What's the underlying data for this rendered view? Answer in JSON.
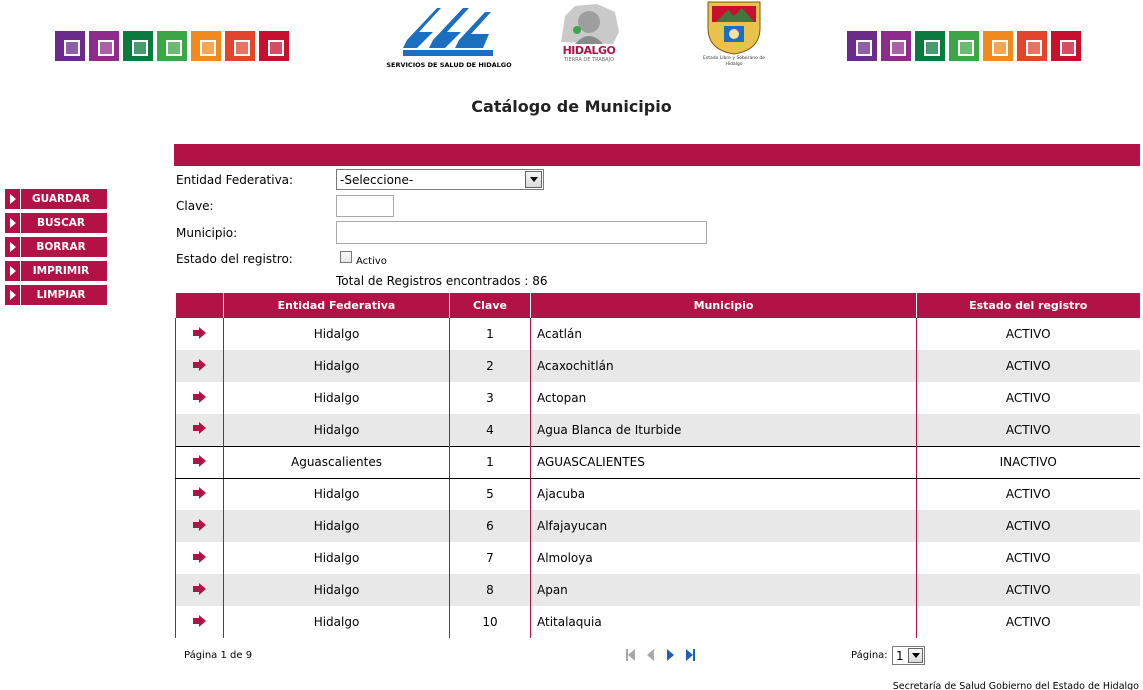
{
  "header": {
    "left_squares": [
      "#6b2b8a",
      "#8e2c8c",
      "#0b7a3e",
      "#3aa645",
      "#f08a1c",
      "#e2452c",
      "#c8102e"
    ],
    "right_squares": [
      "#6b2b8a",
      "#8e2c8c",
      "#0b7a3e",
      "#3aa645",
      "#f08a1c",
      "#e2452c",
      "#c8102e"
    ],
    "logo_ssh_caption": "SERVICIOS DE SALUD DE HIDALGO",
    "logo_hidalgo_text": "HIDALGO",
    "logo_hidalgo_sub": "TIERRA DE TRABAJO",
    "logo_escudo_text": "Estado Libre y Soberano de Hidalgo"
  },
  "page_title": "Catálogo de Municipio",
  "sidebar": {
    "items": [
      {
        "label": "GUARDAR"
      },
      {
        "label": "BUSCAR"
      },
      {
        "label": "BORRAR"
      },
      {
        "label": "IMPRIMIR"
      },
      {
        "label": "LIMPIAR"
      }
    ]
  },
  "form": {
    "entidad_label": "Entidad Federativa:",
    "entidad_value": "-Seleccione-",
    "clave_label": "Clave:",
    "clave_value": "",
    "municipio_label": "Municipio:",
    "municipio_value": "",
    "estado_label": "Estado del registro:",
    "activo_label": "Activo",
    "total_text": "Total de Registros encontrados : 86"
  },
  "table": {
    "headers": [
      "",
      "Entidad Federativa",
      "Clave",
      "Municipio",
      "Estado del registro"
    ],
    "rows": [
      {
        "entidad": "Hidalgo",
        "clave": "1",
        "municipio": "Acatlán",
        "estado": "ACTIVO"
      },
      {
        "entidad": "Hidalgo",
        "clave": "2",
        "municipio": "Acaxochitlán",
        "estado": "ACTIVO"
      },
      {
        "entidad": "Hidalgo",
        "clave": "3",
        "municipio": "Actopan",
        "estado": "ACTIVO"
      },
      {
        "entidad": "Hidalgo",
        "clave": "4",
        "municipio": "Agua Blanca de Iturbide",
        "estado": "ACTIVO"
      },
      {
        "entidad": "Aguascalientes",
        "clave": "1",
        "municipio": "AGUASCALIENTES",
        "estado": "INACTIVO"
      },
      {
        "entidad": "Hidalgo",
        "clave": "5",
        "municipio": "Ajacuba",
        "estado": "ACTIVO"
      },
      {
        "entidad": "Hidalgo",
        "clave": "6",
        "municipio": "Alfajayucan",
        "estado": "ACTIVO"
      },
      {
        "entidad": "Hidalgo",
        "clave": "7",
        "municipio": "Almoloya",
        "estado": "ACTIVO"
      },
      {
        "entidad": "Hidalgo",
        "clave": "8",
        "municipio": "Apan",
        "estado": "ACTIVO"
      },
      {
        "entidad": "Hidalgo",
        "clave": "10",
        "municipio": "Atitalaquia",
        "estado": "ACTIVO"
      }
    ]
  },
  "pager": {
    "status": "Página 1 de 9",
    "page_label": "Página:",
    "page_value": "1",
    "disabled_color": "#a8a8a8",
    "active_color": "#1f5fb4"
  },
  "footer": "Secretaría de Salud Gobierno del Estado de Hidalgo",
  "colors": {
    "accent": "#b31246"
  }
}
